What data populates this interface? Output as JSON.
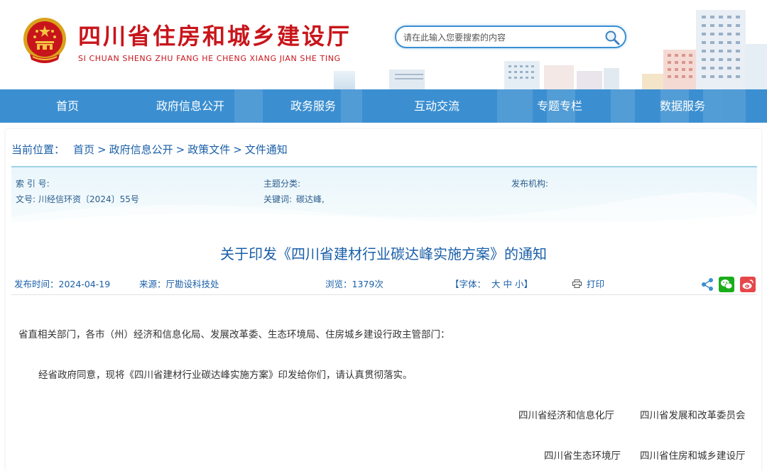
{
  "header": {
    "title_cn": "四川省住房和城乡建设厅",
    "title_en": "SI CHUAN SHENG ZHU FANG HE CHENG XIANG JIAN SHE TING",
    "search_placeholder": "请在此输入您要搜索的内容"
  },
  "nav": {
    "items": [
      {
        "label": "首页"
      },
      {
        "label": "政府信息公开"
      },
      {
        "label": "政务服务"
      },
      {
        "label": "互动交流"
      },
      {
        "label": "专题专栏"
      },
      {
        "label": "数据服务"
      }
    ]
  },
  "breadcrumb": {
    "label": "当前位置：",
    "items": [
      "首页",
      "政府信息公开",
      "政策文件",
      "文件通知"
    ],
    "separator": ">"
  },
  "meta": {
    "index_label": "索 引 号:",
    "topic_label": "主题分类:",
    "publisher_label": "发布机构:",
    "doc_no_label": "文号:",
    "doc_no_value": "川经信环资〔2024〕55号",
    "keywords_label": "关键词:",
    "keywords_value": "碳达峰,"
  },
  "document": {
    "title": "关于印发《四川省建材行业碳达峰实施方案》的通知",
    "publish_time_label": "发布时间：",
    "publish_time": "2024-04-19",
    "source_label": "来源：",
    "source": "厅勘设科技处",
    "views_label": "浏览：",
    "views": "1379次",
    "font_label_open": "【字体：",
    "font_large": "大",
    "font_medium": "中",
    "font_small": "小",
    "font_label_close": "】",
    "print_label": "打印",
    "greeting": "省直相关部门，各市（州）经济和信息化局、发展改革委、生态环境局、住房城乡建设行政主管部门：",
    "paragraph1": "经省政府同意，现将《四川省建材行业碳达峰实施方案》印发给你们，请认真贯彻落实。",
    "signers": [
      "四川省经济和信息化厅",
      "四川省发展和改革委员会",
      "四川省生态环境厅",
      "四川省住房和城乡建设厅"
    ]
  },
  "colors": {
    "brand_red": "#c8151b",
    "nav_blue": "#3b8fd1",
    "link_blue": "#1a5fa8",
    "wechat_green": "#1aad19",
    "weibo_red": "#e6474a"
  }
}
